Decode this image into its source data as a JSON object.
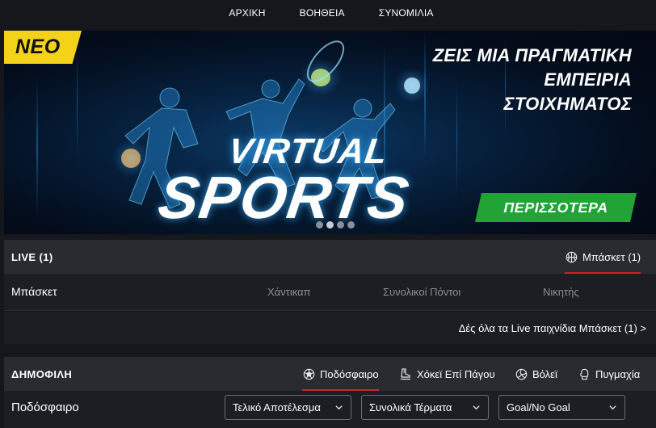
{
  "topnav": {
    "items": [
      "ΑΡΧΙΚΗ",
      "ΒΟΗΘΕΙΑ",
      "ΣΥΝΟΜΙΛΙΑ"
    ]
  },
  "banner": {
    "badge": "ΝΕΟ",
    "headline": [
      "ΖΕΙΣ ΜΙΑ ΠΡΑΓΜΑΤΙΚΗ",
      "ΕΜΠΕΙΡΙΑ",
      "ΣΤΟΙΧΗΜΑΤΟΣ"
    ],
    "title_line1": "VIRTUAL",
    "title_line2": "SPORTS",
    "cta": "ΠΕΡΙΣΣΟΤΕΡΑ",
    "slides": 4,
    "active_slide": 1
  },
  "live": {
    "title": "LIVE (1)",
    "tab": {
      "label": "Μπάσκετ (1)",
      "icon": "basketball-icon"
    },
    "sport": "Μπάσκετ",
    "columns": [
      "Χάντικαπ",
      "Συνολικοί Πόντοι",
      "Νικητής"
    ],
    "see_all": "Δές όλα τα Live παιχνίδια Μπάσκετ (1) >"
  },
  "popular": {
    "title": "ΔΗΜΟΦΙΛΗ",
    "tabs": [
      {
        "label": "Ποδόσφαιρο",
        "icon": "soccer-ball-icon",
        "active": true
      },
      {
        "label": "Χόκεϊ Επί Πάγου",
        "icon": "ice-skate-icon",
        "active": false
      },
      {
        "label": "Βόλεϊ",
        "icon": "volleyball-icon",
        "active": false
      },
      {
        "label": "Πυγμαχία",
        "icon": "boxing-glove-icon",
        "active": false
      }
    ],
    "sport": "Ποδόσφαιρο",
    "selects": [
      "Τελικό Αποτέλεσμα",
      "Συνολικά Τέρματα",
      "Goal/No Goal"
    ]
  },
  "colors": {
    "accent_red": "#d0212a",
    "badge_yellow": "#f5d21a",
    "cta_green": "#21a336",
    "bg": "#16171c",
    "panel": "#2a2b31"
  }
}
